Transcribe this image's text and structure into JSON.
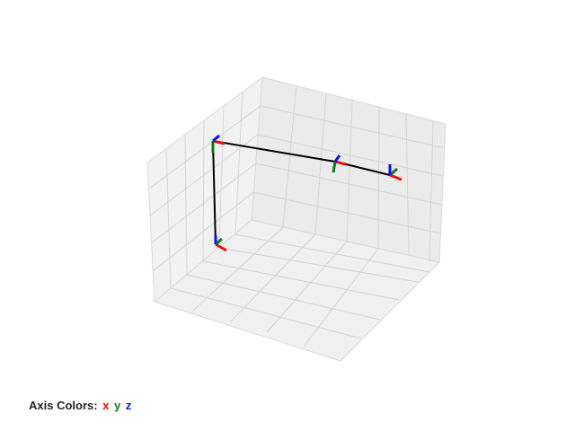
{
  "legend": {
    "label": "Axis Colors:",
    "x_label": "x",
    "y_label": "y",
    "z_label": "z"
  },
  "colors": {
    "x_axis": "#e8110f",
    "y_axis": "#0a7a16",
    "z_axis": "#0a12e6",
    "link": "#000000",
    "pane": "#f2f2f2",
    "grid": "#d0d0d0"
  },
  "scene": {
    "type": "3d-frames-plot",
    "chain_segments": 3,
    "frames": 5
  }
}
